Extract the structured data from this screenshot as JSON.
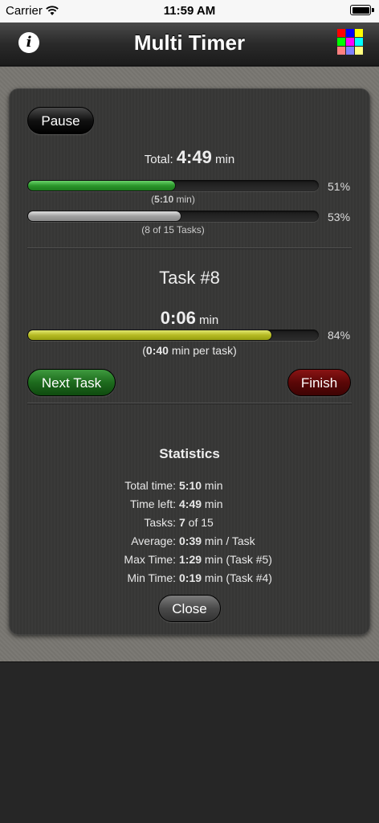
{
  "status_bar": {
    "carrier": "Carrier",
    "time": "11:59 AM"
  },
  "nav": {
    "title": "Multi Timer",
    "info_label": "i",
    "grid_colors": [
      "#ff0000",
      "#0000ff",
      "#ffff00",
      "#00ff00",
      "#ff00ff",
      "#00ffff",
      "#ff8080",
      "#8080ff",
      "#ffff80"
    ]
  },
  "top": {
    "pause_label": "Pause"
  },
  "total": {
    "prefix": "Total:",
    "value": "4:49",
    "unit": "min",
    "time_progress": 0.51,
    "time_pct": "51%",
    "time_open": "(",
    "time_elapsed": "5:10",
    "time_close": " min)",
    "task_progress": 0.53,
    "task_pct": "53%",
    "task_caption": "(8 of 15 Tasks)"
  },
  "task": {
    "title": "Task #8",
    "value": "0:06",
    "unit": "min",
    "progress": 0.84,
    "pct": "84%",
    "per_open": "(",
    "per_value": "0:40",
    "per_rest": " min per task)",
    "next_label": "Next Task",
    "finish_label": "Finish"
  },
  "statistics": {
    "heading": "Statistics",
    "rows": [
      {
        "label": "Total time:",
        "value": "5:10",
        "rest": " min"
      },
      {
        "label": "Time left:",
        "value": "4:49",
        "rest": " min"
      },
      {
        "label": "Tasks:",
        "value": "7",
        "rest": " of 15"
      },
      {
        "label": "Average:",
        "value": "0:39",
        "rest": " min / Task"
      },
      {
        "label": "Max Time:",
        "value": "1:29",
        "rest": " min (Task #5)"
      },
      {
        "label": "Min Time:",
        "value": "0:19",
        "rest": " min (Task #4)"
      }
    ],
    "close_label": "Close"
  },
  "colors": {
    "accent_green": "#2a962a",
    "accent_red": "#5a0707",
    "accent_yellow": "#b6ba24"
  }
}
